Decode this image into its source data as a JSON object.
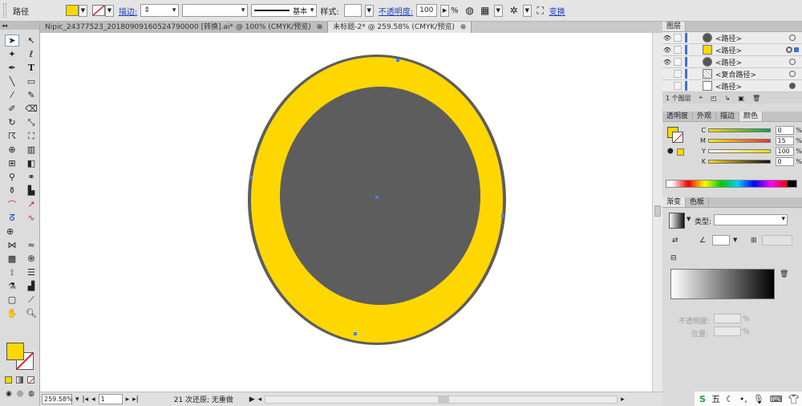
{
  "control_bar": {
    "object_type": "路径",
    "fill_color": "#ffd700",
    "stroke_label": "描边:",
    "stroke_profile": "基本",
    "style_label": "样式:",
    "opacity_label": "不透明度:",
    "opacity_value": "100",
    "opacity_unit": "%",
    "transform_label": "变换"
  },
  "tabs": [
    {
      "label": "Nipic_24377523_20180909160524790000 [转换].ai* @ 100% (CMYK/预览)",
      "close": "⊗"
    },
    {
      "label": "未标题-2* @ 259.58% (CMYK/预览)",
      "close": "⊗"
    }
  ],
  "status_bar": {
    "zoom": "259.58%",
    "page": "1",
    "message": "21 次还原; 无重做"
  },
  "layers_panel": {
    "title": "图层",
    "layers": [
      {
        "name": "<路径>",
        "thumb": "#555555"
      },
      {
        "name": "<路径>",
        "thumb": "#ffd700"
      },
      {
        "name": "<路径>",
        "thumb": "#555555"
      },
      {
        "name": "<复合路径>",
        "thumb": "#dddddd"
      },
      {
        "name": "<路径>",
        "thumb": "#ffffff"
      }
    ],
    "count": "1 个图层"
  },
  "color_panel": {
    "tabs": [
      "透明度",
      "外观",
      "描边",
      "颜色"
    ],
    "channels": [
      {
        "ch": "C",
        "value": "0"
      },
      {
        "ch": "M",
        "value": "15"
      },
      {
        "ch": "Y",
        "value": "100"
      },
      {
        "ch": "K",
        "value": "0"
      }
    ],
    "percent": "%"
  },
  "gradient_panel": {
    "tabs": [
      "渐变",
      "色板"
    ],
    "type_label": "类型:",
    "opacity_label": "不透明度:",
    "location_label": "位置:",
    "percent": "%"
  },
  "canvas": {
    "outer_color": "#5d5d5d",
    "ring_color": "#ffd700",
    "inner_color": "#5d5d5d",
    "anchor_color": "#4a7fe8"
  },
  "ime": {
    "mode": "五"
  }
}
